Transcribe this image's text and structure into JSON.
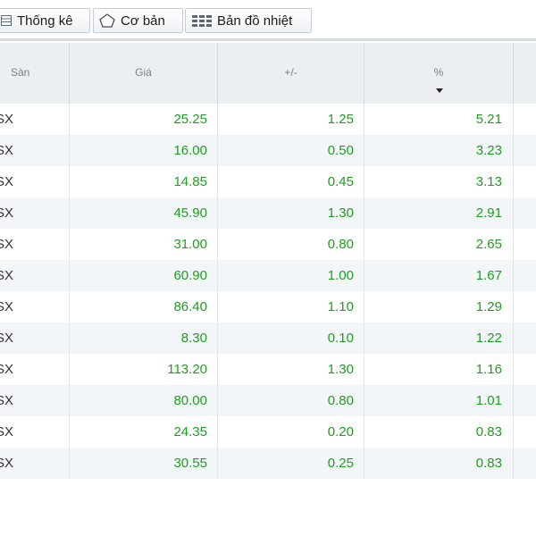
{
  "toolbar": {
    "tabs": [
      {
        "label": "Thống kê",
        "icon": "table-icon"
      },
      {
        "label": "Cơ bản",
        "icon": "pentagon-icon"
      },
      {
        "label": "Bản đồ nhiệt",
        "icon": "heatmap-grid-icon"
      }
    ]
  },
  "table": {
    "columns": [
      "Sàn",
      "Giá",
      "+/-",
      "%"
    ],
    "sort_column": "%",
    "sort_direction": "descending",
    "value_color": "#1e9e1e",
    "rows": [
      {
        "exchange": "SX",
        "price": "25.25",
        "change": "1.25",
        "percent": "5.21"
      },
      {
        "exchange": "SX",
        "price": "16.00",
        "change": "0.50",
        "percent": "3.23"
      },
      {
        "exchange": "SX",
        "price": "14.85",
        "change": "0.45",
        "percent": "3.13"
      },
      {
        "exchange": "SX",
        "price": "45.90",
        "change": "1.30",
        "percent": "2.91"
      },
      {
        "exchange": "SX",
        "price": "31.00",
        "change": "0.80",
        "percent": "2.65"
      },
      {
        "exchange": "SX",
        "price": "60.90",
        "change": "1.00",
        "percent": "1.67"
      },
      {
        "exchange": "SX",
        "price": "86.40",
        "change": "1.10",
        "percent": "1.29"
      },
      {
        "exchange": "SX",
        "price": "8.30",
        "change": "0.10",
        "percent": "1.22"
      },
      {
        "exchange": "SX",
        "price": "113.20",
        "change": "1.30",
        "percent": "1.16"
      },
      {
        "exchange": "SX",
        "price": "80.00",
        "change": "0.80",
        "percent": "1.01"
      },
      {
        "exchange": "SX",
        "price": "24.35",
        "change": "0.20",
        "percent": "0.83"
      },
      {
        "exchange": "SX",
        "price": "30.55",
        "change": "0.25",
        "percent": "0.83"
      }
    ]
  }
}
